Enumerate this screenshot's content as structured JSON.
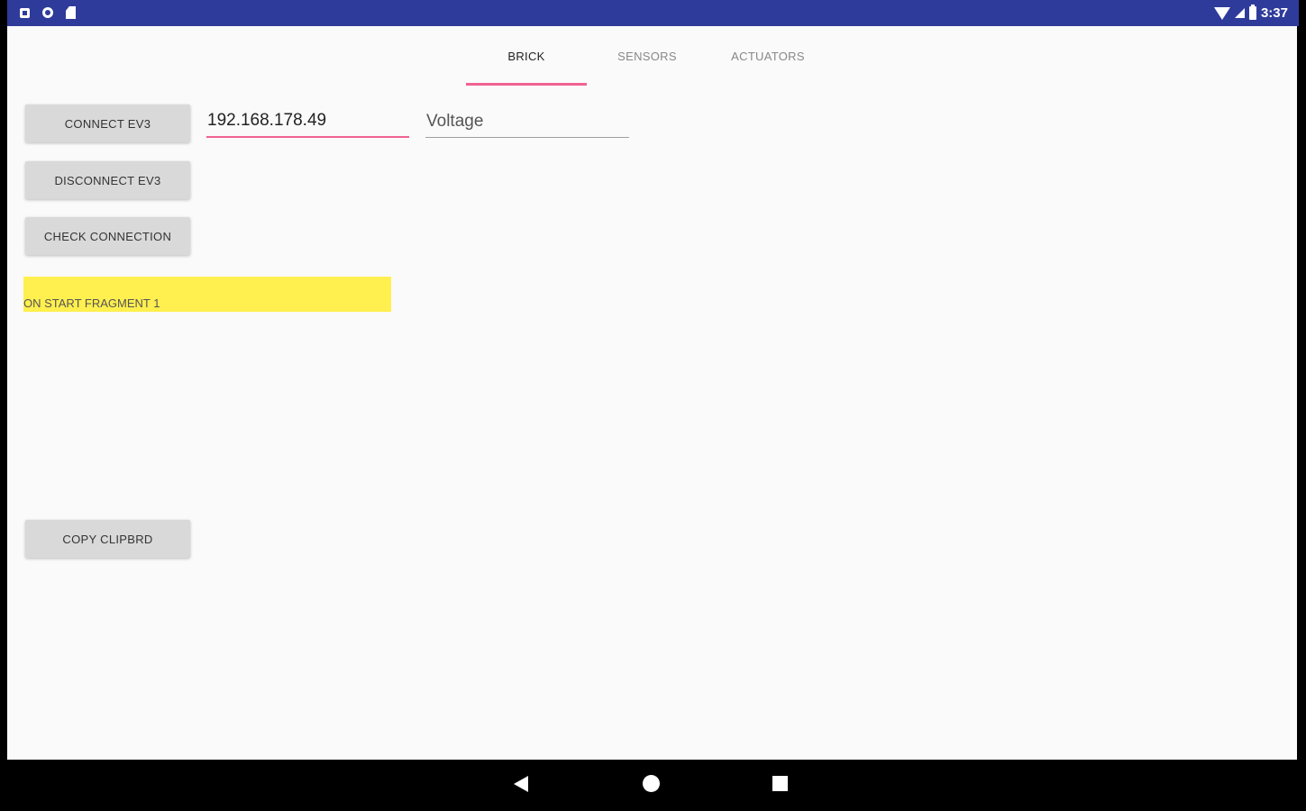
{
  "status_bar": {
    "time": "3:37",
    "left_icons": [
      "notification-square-icon",
      "sync-circle-icon",
      "sd-card-icon"
    ],
    "right_icons": [
      "wifi-icon",
      "cell-signal-icon",
      "battery-icon"
    ]
  },
  "tabs": [
    {
      "label": "BRICK",
      "active": true
    },
    {
      "label": "SENSORS",
      "active": false
    },
    {
      "label": "ACTUATORS",
      "active": false
    }
  ],
  "buttons": {
    "connect": "CONNECT EV3",
    "disconnect": "DISCONNECT EV3",
    "check": "CHECK CONNECTION",
    "copy": "COPY CLIPBRD"
  },
  "fields": {
    "ip_value": "192.168.178.49",
    "voltage_value": "Voltage"
  },
  "status_message": "ON START FRAGMENT 1",
  "colors": {
    "status_bar": "#2f3b9a",
    "accent": "#f06292",
    "highlight": "#ffef4f",
    "background": "#fafafa"
  }
}
